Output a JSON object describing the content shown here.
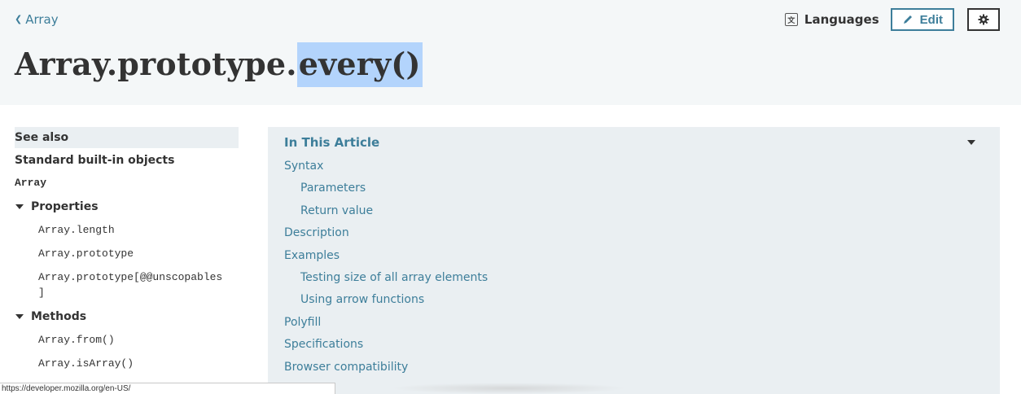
{
  "header": {
    "back_label": "Array",
    "title_prefix": "Array.prototype.",
    "title_selected": "every()",
    "languages_label": "Languages",
    "edit_label": "Edit"
  },
  "sidebar": {
    "see_also": "See also",
    "standard_objects": "Standard built-in objects",
    "array_label": "Array",
    "properties_label": "Properties",
    "properties": [
      "Array.length",
      "Array.prototype",
      "Array.prototype[@@unscopables\n]"
    ],
    "methods_label": "Methods",
    "methods": [
      "Array.from()",
      "Array.isArray()"
    ]
  },
  "toc": {
    "title": "In This Article",
    "items": [
      {
        "label": "Syntax",
        "level": 1
      },
      {
        "label": "Parameters",
        "level": 2
      },
      {
        "label": "Return value",
        "level": 2
      },
      {
        "label": "Description",
        "level": 1
      },
      {
        "label": "Examples",
        "level": 1
      },
      {
        "label": "Testing size of all array elements",
        "level": 2
      },
      {
        "label": "Using arrow functions",
        "level": 2
      },
      {
        "label": "Polyfill",
        "level": 1
      },
      {
        "label": "Specifications",
        "level": 1
      },
      {
        "label": "Browser compatibility",
        "level": 1
      }
    ]
  },
  "status": {
    "url": "https://developer.mozilla.org/en-US/"
  },
  "colors": {
    "link": "#3d7e9a",
    "header_bg": "#f4f7f8",
    "panel_bg": "#eaeff2",
    "selection": "#b3d4fc"
  }
}
